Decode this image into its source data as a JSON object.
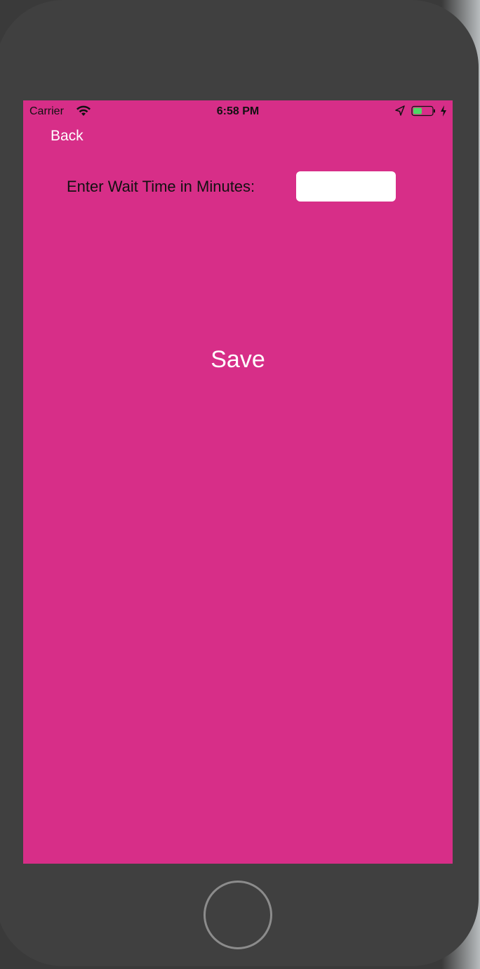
{
  "status_bar": {
    "carrier": "Carrier",
    "time": "6:58 PM",
    "icons": [
      "wifi-icon",
      "location-arrow-icon",
      "battery-icon",
      "charging-bolt-icon"
    ],
    "battery_color": "#4cd964"
  },
  "nav": {
    "back_label": "Back"
  },
  "form": {
    "wait_label": "Enter Wait Time in Minutes:",
    "wait_value": "",
    "save_label": "Save"
  },
  "colors": {
    "screen_background": "#d72e88",
    "device_body": "#404040",
    "button_text": "#ffffff"
  }
}
